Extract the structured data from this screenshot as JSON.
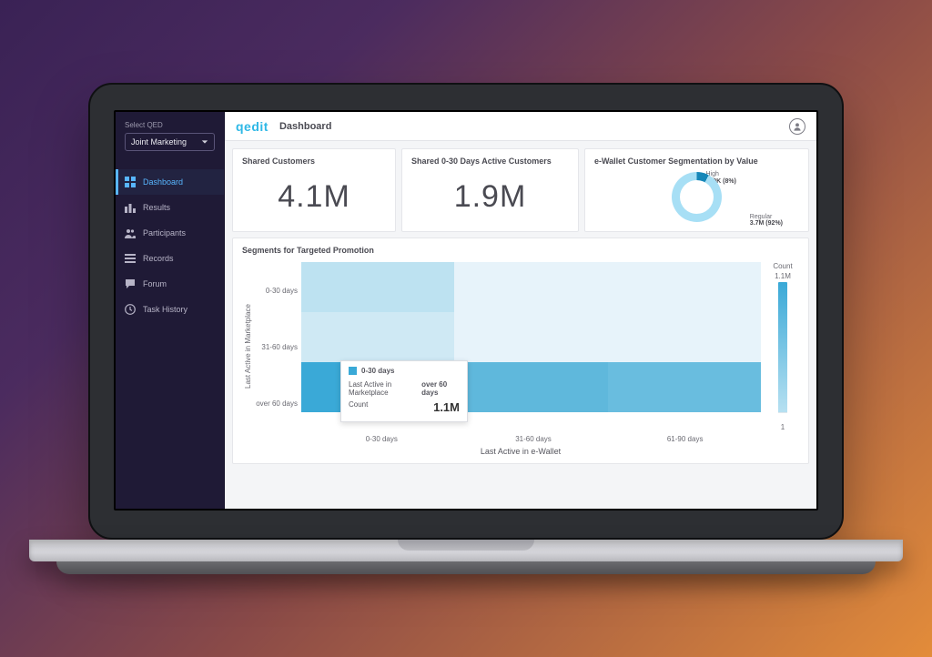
{
  "brand_logo_text": "qedit",
  "header": {
    "page_title": "Dashboard"
  },
  "sidebar": {
    "select_label": "Select QED",
    "select_value": "Joint Marketing",
    "items": [
      {
        "label": "Dashboard",
        "icon": "grid-icon",
        "active": true
      },
      {
        "label": "Results",
        "icon": "bar-chart-icon",
        "active": false
      },
      {
        "label": "Participants",
        "icon": "people-icon",
        "active": false
      },
      {
        "label": "Records",
        "icon": "list-icon",
        "active": false
      },
      {
        "label": "Forum",
        "icon": "chat-icon",
        "active": false
      },
      {
        "label": "Task History",
        "icon": "clock-icon",
        "active": false
      }
    ]
  },
  "cards": {
    "shared_customers": {
      "title": "Shared Customers",
      "value": "4.1M"
    },
    "active_customers": {
      "title": "Shared 0-30 Days Active Customers",
      "value": "1.9M"
    },
    "segmentation": {
      "title": "e-Wallet Customer Segmentation by Value"
    }
  },
  "chart_data": [
    {
      "type": "pie",
      "title": "e-Wallet Customer Segmentation by Value",
      "series": [
        {
          "name": "High",
          "value": 350000,
          "pct": 8,
          "display": "350K"
        },
        {
          "name": "Regular",
          "value": 3700000,
          "pct": 92,
          "display": "3.7M"
        }
      ]
    },
    {
      "type": "heatmap",
      "title": "Segments for Targeted Promotion",
      "xlabel": "Last Active in e-Wallet",
      "ylabel": "Last Active in Marketplace",
      "x_categories": [
        "0-30 days",
        "31-60 days",
        "61-90 days"
      ],
      "y_categories": [
        "0-30 days",
        "31-60 days",
        "over 60 days"
      ],
      "values": [
        [
          0.4,
          0.05,
          0.05
        ],
        [
          0.25,
          0.05,
          0.05
        ],
        [
          1.1,
          0.85,
          0.8
        ]
      ],
      "value_unit": "M",
      "legend": {
        "title": "Count",
        "max_display": "1.1M",
        "min_display": "1"
      }
    }
  ],
  "heatmap_colors": [
    [
      "#bde2f1",
      "#e7f3fa",
      "#e7f3fa"
    ],
    [
      "#cfe9f4",
      "#e7f3fa",
      "#e7f3fa"
    ],
    [
      "#3aa9d7",
      "#5fb8dc",
      "#69bddf"
    ]
  ],
  "tooltip": {
    "series_label": "0-30 days",
    "dimension_name": "Last Active in Marketplace",
    "dimension_value": "over 60 days",
    "count_label": "Count",
    "count_value": "1.1M"
  },
  "colors": {
    "accent": "#58b6ff",
    "donut_high": "#1787b8",
    "donut_reg": "#a7dff5"
  }
}
